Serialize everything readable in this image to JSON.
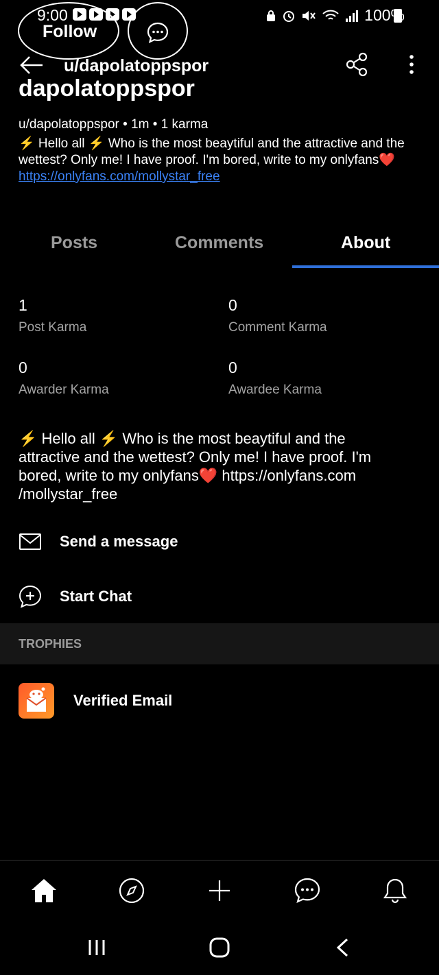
{
  "status_bar": {
    "time": "9:00",
    "battery": "100%"
  },
  "header": {
    "follow_label": "Follow",
    "username": "u/dapolatoppspor"
  },
  "profile": {
    "display_name": "dapolatoppspor",
    "meta": "u/dapolatoppspor • 1m • 1 karma",
    "bio_text": "⚡ Hello all ⚡ Who is the most beaytiful and the attractive and the wettest? Only me! I have proof. I'm bored, write to my onlyfans❤️ ",
    "bio_link": "https://onlyfans.com/mollystar_free"
  },
  "tabs": [
    {
      "label": "Posts"
    },
    {
      "label": "Comments"
    },
    {
      "label": "About"
    }
  ],
  "karma": {
    "post": {
      "value": "1",
      "label": "Post Karma"
    },
    "comment": {
      "value": "0",
      "label": "Comment Karma"
    },
    "awarder": {
      "value": "0",
      "label": "Awarder Karma"
    },
    "awardee": {
      "value": "0",
      "label": "Awardee Karma"
    }
  },
  "about_text": "⚡ Hello all ⚡ Who is the most beaytiful and the attractive and the wettest? Only me! I have proof. I'm bored, write to my onlyfans❤️ https://onlyfans.com /mollystar_free",
  "actions": {
    "send_message": "Send a message",
    "start_chat": "Start Chat"
  },
  "trophies": {
    "title": "TROPHIES",
    "items": [
      {
        "label": "Verified Email"
      }
    ]
  },
  "colors": {
    "accent": "#2f6fd8",
    "link": "#3b82f6",
    "background": "#000000"
  }
}
